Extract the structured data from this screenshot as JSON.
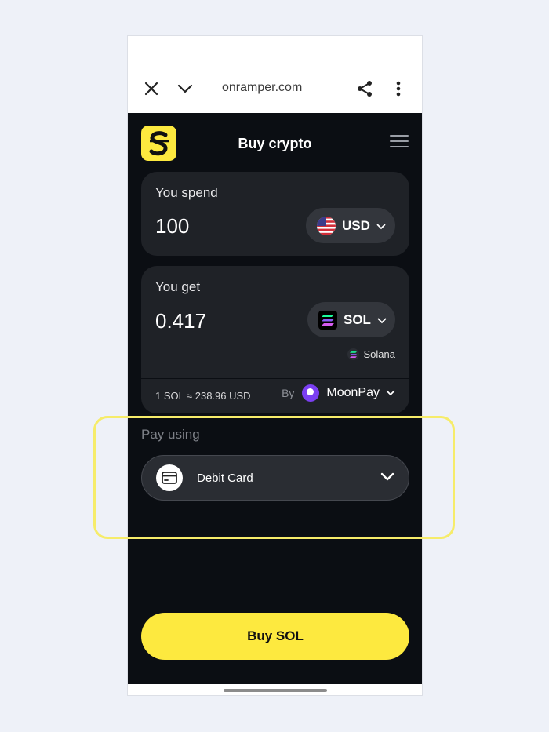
{
  "browser": {
    "url": "onramper.com"
  },
  "app": {
    "title": "Buy crypto"
  },
  "spend": {
    "label": "You spend",
    "amount": "100",
    "currency": "USD"
  },
  "get": {
    "label": "You get",
    "amount": "0.417",
    "currency": "SOL",
    "network": "Solana"
  },
  "quote": {
    "rate": "1 SOL ≈ 238.96 USD",
    "by_label": "By",
    "provider": "MoonPay"
  },
  "payment": {
    "label": "Pay using",
    "method": "Debit Card"
  },
  "cta": {
    "label": "Buy SOL"
  },
  "colors": {
    "accent": "#fde93f",
    "background": "#0b0e13",
    "card": "#1f2227",
    "highlight": "#f6ec6a"
  }
}
